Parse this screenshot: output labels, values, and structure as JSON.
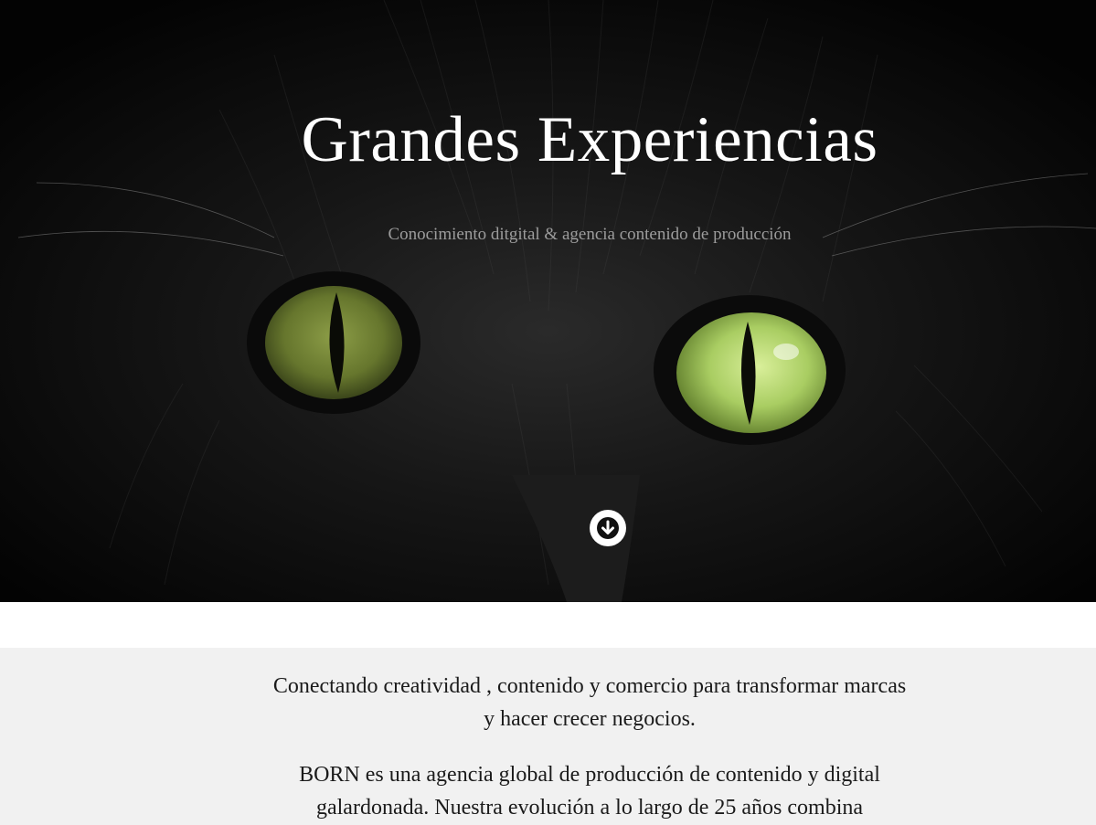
{
  "hero": {
    "title": "Grandes Experiencias",
    "subtitle": "Conocimiento ditgital & agencia contenido de producción",
    "image": "black-cat-green-eyes-photo",
    "scroll_icon": "arrow-down-circle-icon"
  },
  "intro": {
    "lead_line1": "Conectando creatividad , contenido y comercio para transformar marcas",
    "lead_line2": "y hacer crecer negocios.",
    "body_line1": "BORN es una agencia global de producción de contenido y digital",
    "body_line2": "galardonada. Nuestra evolución a lo largo de 25 años combina"
  },
  "colors": {
    "hero_bg": "#060606",
    "eye_green": "#b5d46a",
    "section_bg": "#f1f1f1",
    "text": "#1b1b1b",
    "subtitle": "#9c9c9c"
  }
}
